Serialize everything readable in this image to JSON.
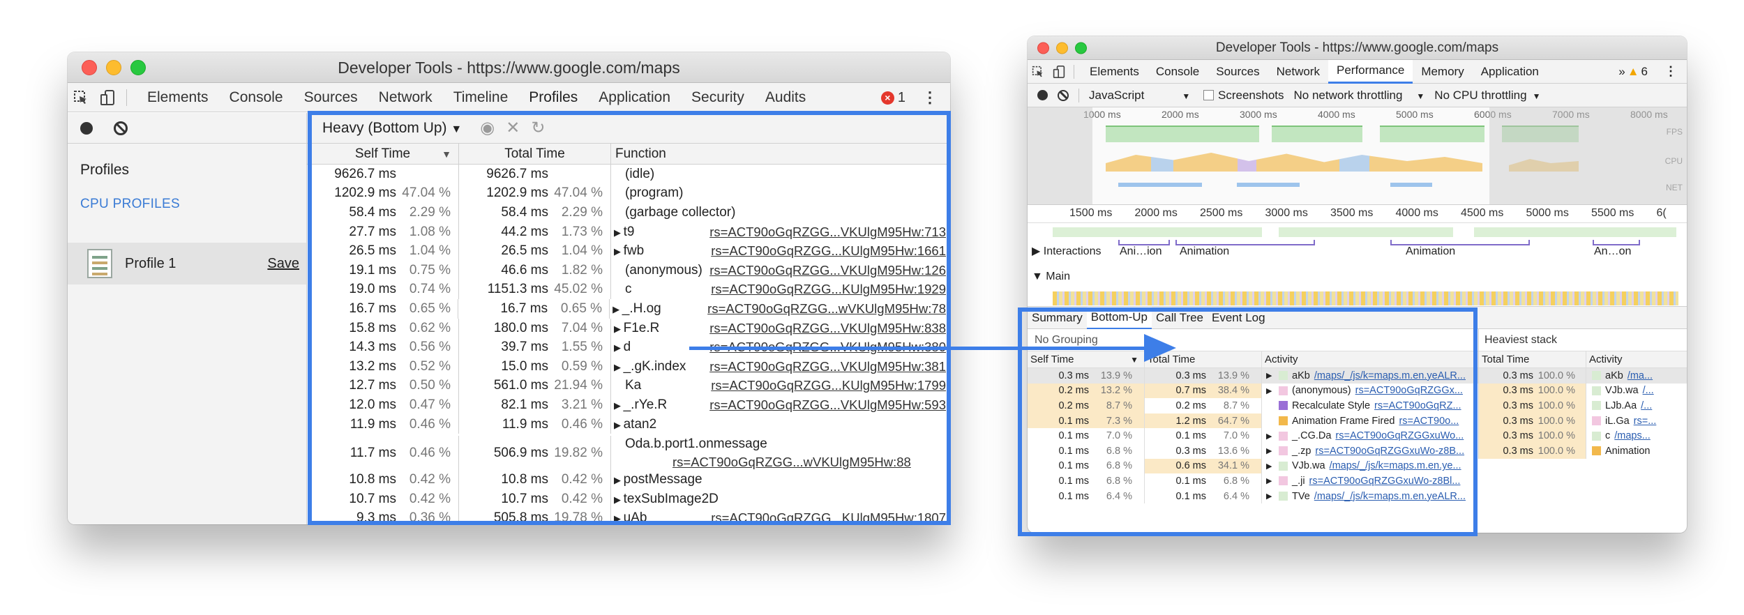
{
  "left_window": {
    "title": "Developer Tools - https://www.google.com/maps",
    "tabs": [
      "Elements",
      "Console",
      "Sources",
      "Network",
      "Timeline",
      "Profiles",
      "Application",
      "Security",
      "Audits"
    ],
    "active_tab": "Profiles",
    "error_count": "1",
    "sidebar": {
      "heading": "Profiles",
      "section": "CPU PROFILES",
      "item": "Profile 1",
      "save": "Save"
    },
    "view_select": "Heavy (Bottom Up)",
    "columns": {
      "self": "Self Time",
      "total": "Total Time",
      "function": "Function"
    },
    "rows": [
      {
        "self": "9626.7 ms",
        "self_pct": "",
        "total": "9626.7 ms",
        "total_pct": "",
        "fn": "(idle)",
        "expand": false,
        "link": ""
      },
      {
        "self": "1202.9 ms",
        "self_pct": "47.04 %",
        "total": "1202.9 ms",
        "total_pct": "47.04 %",
        "fn": "(program)",
        "expand": false,
        "link": ""
      },
      {
        "self": "58.4 ms",
        "self_pct": "2.29 %",
        "total": "58.4 ms",
        "total_pct": "2.29 %",
        "fn": "(garbage collector)",
        "expand": false,
        "link": ""
      },
      {
        "self": "27.7 ms",
        "self_pct": "1.08 %",
        "total": "44.2 ms",
        "total_pct": "1.73 %",
        "fn": "t9",
        "expand": true,
        "link": "rs=ACT90oGqRZGG...VKUlgM95Hw:713"
      },
      {
        "self": "26.5 ms",
        "self_pct": "1.04 %",
        "total": "26.5 ms",
        "total_pct": "1.04 %",
        "fn": "fwb",
        "expand": true,
        "link": "rs=ACT90oGqRZGG...KUlgM95Hw:1661"
      },
      {
        "self": "19.1 ms",
        "self_pct": "0.75 %",
        "total": "46.6 ms",
        "total_pct": "1.82 %",
        "fn": "(anonymous)",
        "expand": false,
        "link": "rs=ACT90oGqRZGG...VKUlgM95Hw:126"
      },
      {
        "self": "19.0 ms",
        "self_pct": "0.74 %",
        "total": "1151.3 ms",
        "total_pct": "45.02 %",
        "fn": "c",
        "expand": false,
        "link": "rs=ACT90oGqRZGG...KUlgM95Hw:1929"
      },
      {
        "self": "16.7 ms",
        "self_pct": "0.65 %",
        "total": "16.7 ms",
        "total_pct": "0.65 %",
        "fn": "_.H.og",
        "expand": true,
        "link": "rs=ACT90oGqRZGG...wVKUlgM95Hw:78"
      },
      {
        "self": "15.8 ms",
        "self_pct": "0.62 %",
        "total": "180.0 ms",
        "total_pct": "7.04 %",
        "fn": "F1e.R",
        "expand": true,
        "link": "rs=ACT90oGqRZGG...VKUlgM95Hw:838"
      },
      {
        "self": "14.3 ms",
        "self_pct": "0.56 %",
        "total": "39.7 ms",
        "total_pct": "1.55 %",
        "fn": "d",
        "expand": true,
        "link": "rs=ACT90oGqRZGG...VKUlgM95Hw:380"
      },
      {
        "self": "13.2 ms",
        "self_pct": "0.52 %",
        "total": "15.0 ms",
        "total_pct": "0.59 %",
        "fn": "_.gK.index",
        "expand": true,
        "link": "rs=ACT90oGqRZGG...VKUlgM95Hw:381"
      },
      {
        "self": "12.7 ms",
        "self_pct": "0.50 %",
        "total": "561.0 ms",
        "total_pct": "21.94 %",
        "fn": "Ka",
        "expand": false,
        "link": "rs=ACT90oGqRZGG...KUlgM95Hw:1799"
      },
      {
        "self": "12.0 ms",
        "self_pct": "0.47 %",
        "total": "82.1 ms",
        "total_pct": "3.21 %",
        "fn": "_.rYe.R",
        "expand": true,
        "link": "rs=ACT90oGqRZGG...VKUlgM95Hw:593"
      },
      {
        "self": "11.9 ms",
        "self_pct": "0.46 %",
        "total": "11.9 ms",
        "total_pct": "0.46 %",
        "fn": "atan2",
        "expand": true,
        "link": ""
      },
      {
        "self": "11.7 ms",
        "self_pct": "0.46 %",
        "total": "506.9 ms",
        "total_pct": "19.82 %",
        "fn": "Oda.b.port1.onmessage",
        "expand": false,
        "link": "rs=ACT90oGqRZGG...wVKUlgM95Hw:88",
        "tall": true
      },
      {
        "self": "10.8 ms",
        "self_pct": "0.42 %",
        "total": "10.8 ms",
        "total_pct": "0.42 %",
        "fn": "postMessage",
        "expand": true,
        "link": ""
      },
      {
        "self": "10.7 ms",
        "self_pct": "0.42 %",
        "total": "10.7 ms",
        "total_pct": "0.42 %",
        "fn": "texSubImage2D",
        "expand": true,
        "link": ""
      },
      {
        "self": "9.3 ms",
        "self_pct": "0.36 %",
        "total": "505.8 ms",
        "total_pct": "19.78 %",
        "fn": "uAb",
        "expand": true,
        "link": "rs=ACT90oGqRZGG...KUlgM95Hw:1807"
      }
    ]
  },
  "right_window": {
    "title": "Developer Tools - https://www.google.com/maps",
    "tabs": [
      "Elements",
      "Console",
      "Sources",
      "Network",
      "Performance",
      "Memory",
      "Application"
    ],
    "active_tab": "Performance",
    "more": "»",
    "warning_count": "6",
    "toolbar": {
      "js": "JavaScript",
      "screenshots": "Screenshots",
      "network": "No network throttling",
      "cpu": "No CPU throttling"
    },
    "overview_ticks": [
      "1000 ms",
      "2000 ms",
      "3000 ms",
      "4000 ms",
      "5000 ms",
      "6000 ms",
      "7000 ms",
      "8000 ms"
    ],
    "overview_labels": [
      "FPS",
      "CPU",
      "NET"
    ],
    "ruler_ticks": [
      "1500 ms",
      "2000 ms",
      "2500 ms",
      "3000 ms",
      "3500 ms",
      "4000 ms",
      "4500 ms",
      "5000 ms",
      "5500 ms",
      "6("
    ],
    "interactions_label": "Interactions",
    "animations": [
      "Ani…ion",
      "Animation",
      "Animation",
      "An…on"
    ],
    "main_label": "Main",
    "bottom_tabs": [
      "Summary",
      "Bottom-Up",
      "Call Tree",
      "Event Log"
    ],
    "active_bottom_tab": "Bottom-Up",
    "grouping": "No Grouping",
    "columns": {
      "self": "Self Time",
      "total": "Total Time",
      "activity": "Activity"
    },
    "rows": [
      {
        "self": "0.3 ms",
        "self_pct": "13.9 %",
        "total": "0.3 ms",
        "total_pct": "13.9 %",
        "name": "aKb",
        "link": "/maps/_/js/k=maps.m.en.yeALR...",
        "color": "#d8ecd2",
        "expand": true
      },
      {
        "self": "0.2 ms",
        "self_pct": "13.2 %",
        "total": "0.7 ms",
        "total_pct": "38.4 %",
        "name": "(anonymous)",
        "link": "rs=ACT90oGqRZGGx...",
        "color": "#f2c7e0",
        "expand": true
      },
      {
        "self": "0.2 ms",
        "self_pct": "8.7 %",
        "total": "0.2 ms",
        "total_pct": "8.7 %",
        "name": "Recalculate Style",
        "link": "rs=ACT90oGqRZ...",
        "color": "#9a6fd6",
        "expand": false
      },
      {
        "self": "0.1 ms",
        "self_pct": "7.3 %",
        "total": "1.2 ms",
        "total_pct": "64.7 %",
        "name": "Animation Frame Fired",
        "link": "rs=ACT90o...",
        "color": "#f2b84b",
        "expand": false
      },
      {
        "self": "0.1 ms",
        "self_pct": "7.0 %",
        "total": "0.1 ms",
        "total_pct": "7.0 %",
        "name": "_.CG.Da",
        "link": "rs=ACT90oGqRZGGxuWo...",
        "color": "#f2c7e0",
        "expand": true
      },
      {
        "self": "0.1 ms",
        "self_pct": "6.8 %",
        "total": "0.3 ms",
        "total_pct": "13.6 %",
        "name": "_.zp",
        "link": "rs=ACT90oGqRZGGxuWo-z8B...",
        "color": "#f2c7e0",
        "expand": true
      },
      {
        "self": "0.1 ms",
        "self_pct": "6.8 %",
        "total": "0.6 ms",
        "total_pct": "34.1 %",
        "name": "VJb.wa",
        "link": "/maps/_/js/k=maps.m.en.ye...",
        "color": "#d8ecd2",
        "expand": true
      },
      {
        "self": "0.1 ms",
        "self_pct": "6.8 %",
        "total": "0.1 ms",
        "total_pct": "6.8 %",
        "name": "_.ji",
        "link": "rs=ACT90oGqRZGGxuWo-z8Bl...",
        "color": "#f2c7e0",
        "expand": true
      },
      {
        "self": "0.1 ms",
        "self_pct": "6.4 %",
        "total": "0.1 ms",
        "total_pct": "6.4 %",
        "name": "TVe",
        "link": "/maps/_/js/k=maps.m.en.yeALR...",
        "color": "#d8ecd2",
        "expand": true
      }
    ],
    "heaviest": {
      "title": "Heaviest stack",
      "columns": {
        "total": "Total Time",
        "activity": "Activity"
      },
      "rows": [
        {
          "total": "0.3 ms",
          "pct": "100.0 %",
          "name": "aKb",
          "link": "/ma...",
          "color": "#d8ecd2"
        },
        {
          "total": "0.3 ms",
          "pct": "100.0 %",
          "name": "VJb.wa",
          "link": "/...",
          "color": "#d8ecd2"
        },
        {
          "total": "0.3 ms",
          "pct": "100.0 %",
          "name": "LJb.Aa",
          "link": "/...",
          "color": "#d8ecd2"
        },
        {
          "total": "0.3 ms",
          "pct": "100.0 %",
          "name": "iL.Ga",
          "link": "rs=...",
          "color": "#f2c7e0"
        },
        {
          "total": "0.3 ms",
          "pct": "100.0 %",
          "name": "c",
          "link": "/maps...",
          "color": "#d8ecd2"
        },
        {
          "total": "0.3 ms",
          "pct": "100.0 %",
          "name": "Animation",
          "link": "",
          "color": "#f2b84b"
        }
      ]
    }
  },
  "colors": {
    "highlight": "#3d7ee8",
    "link": "#2a5db0",
    "heat": "#fbe9c6"
  }
}
